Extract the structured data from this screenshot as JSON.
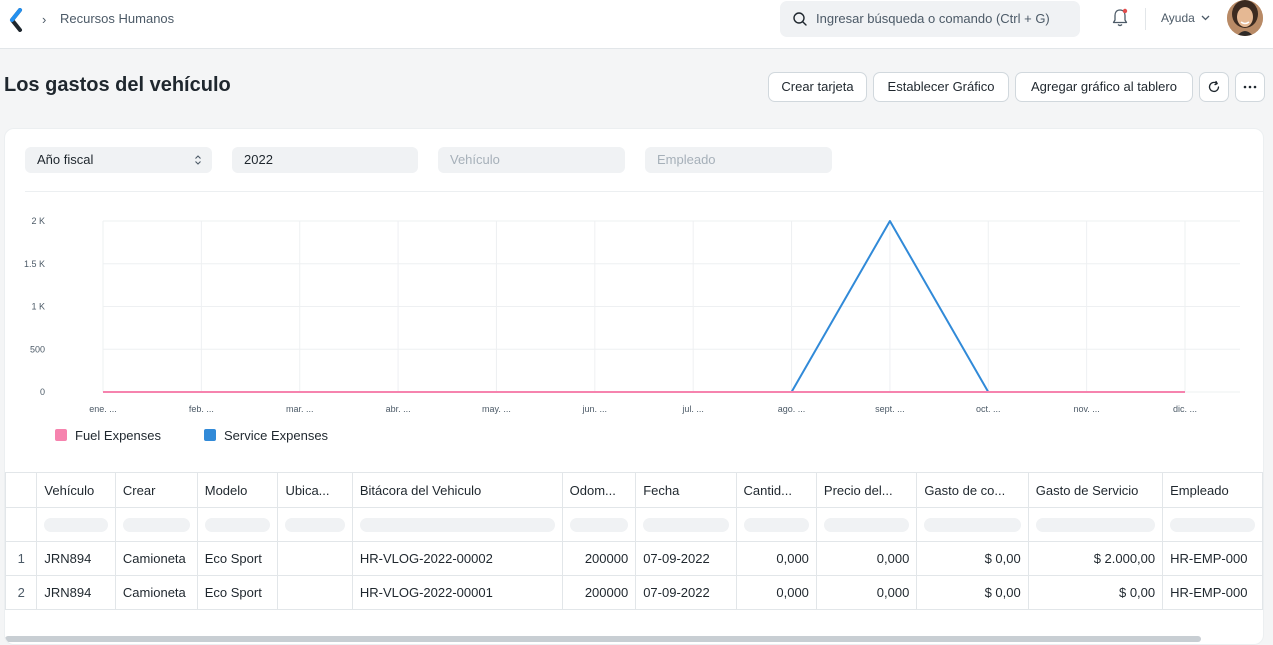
{
  "navbar": {
    "breadcrumb": "Recursos Humanos",
    "search_placeholder": "Ingresar búsqueda o comando (Ctrl + G)",
    "help_label": "Ayuda"
  },
  "page": {
    "title": "Los gastos del vehículo",
    "buttons": {
      "create_card": "Crear tarjeta",
      "set_chart": "Establecer Gráfico",
      "add_chart": "Agregar gráfico al tablero"
    }
  },
  "filters": {
    "fiscal_year_select": "Año fiscal",
    "year_value": "2022",
    "vehicle_placeholder": "Vehículo",
    "employee_placeholder": "Empleado"
  },
  "chart_data": {
    "type": "line",
    "categories": [
      "ene. ...",
      "feb. ...",
      "mar. ...",
      "abr. ...",
      "may. ...",
      "jun. ...",
      "jul. ...",
      "ago. ...",
      "sept. ...",
      "oct. ...",
      "nov. ...",
      "dic. ..."
    ],
    "y_ticks": [
      "0",
      "500",
      "1 K",
      "1.5 K",
      "2 K"
    ],
    "ylim": [
      0,
      2000
    ],
    "grid": true,
    "legend_position": "bottom-left",
    "series": [
      {
        "name": "Fuel Expenses",
        "color": "#f683ae",
        "values": [
          0,
          0,
          0,
          0,
          0,
          0,
          0,
          0,
          0,
          0,
          0,
          0
        ]
      },
      {
        "name": "Service Expenses",
        "color": "#318ad8",
        "values": [
          0,
          0,
          0,
          0,
          0,
          0,
          0,
          0,
          2000,
          0,
          0,
          0
        ]
      }
    ]
  },
  "table": {
    "columns": [
      "Vehículo",
      "Crear",
      "Modelo",
      "Ubica...",
      "Bitácora del Vehiculo",
      "Odom...",
      "Fecha",
      "Cantid...",
      "Precio del...",
      "Gasto de co...",
      "Gasto de Servicio",
      "Empleado"
    ],
    "rows": [
      {
        "index": "1",
        "cells": [
          "JRN894",
          "Camioneta",
          "Eco Sport",
          "",
          "HR-VLOG-2022-00002",
          "200000",
          "07-09-2022",
          "0,000",
          "0,000",
          "$ 0,00",
          "$ 2.000,00",
          "HR-EMP-000"
        ]
      },
      {
        "index": "2",
        "cells": [
          "JRN894",
          "Camioneta",
          "Eco Sport",
          "",
          "HR-VLOG-2022-00001",
          "200000",
          "07-09-2022",
          "0,000",
          "0,000",
          "$ 0,00",
          "$ 0,00",
          "HR-EMP-000"
        ]
      }
    ]
  }
}
